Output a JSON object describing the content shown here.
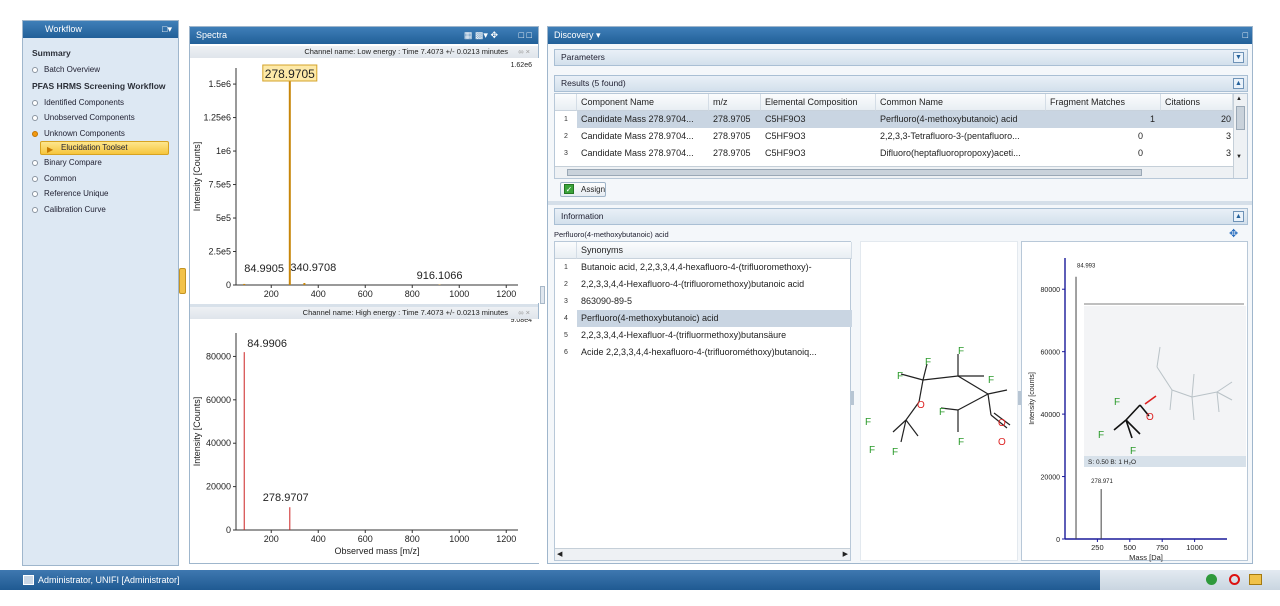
{
  "workflow": {
    "title": "Workflow",
    "items": [
      {
        "label": "Summary",
        "type": "header"
      },
      {
        "label": "Batch Overview",
        "type": "item"
      },
      {
        "label": "PFAS HRMS Screening Workflow",
        "type": "header"
      },
      {
        "label": "Identified Components",
        "type": "item"
      },
      {
        "label": "Unobserved Components",
        "type": "item"
      },
      {
        "label": "Unknown Components",
        "type": "item",
        "status": "active"
      },
      {
        "label": "Elucidation Toolset",
        "type": "selected"
      },
      {
        "label": "Binary Compare",
        "type": "item"
      },
      {
        "label": "Common",
        "type": "item"
      },
      {
        "label": "Reference Unique",
        "type": "item"
      },
      {
        "label": "Calibration Curve",
        "type": "item"
      }
    ]
  },
  "spectra": {
    "title": "Spectra",
    "low": {
      "channel": "Channel name: Low energy : Time 7.4073 +/- 0.0213 minutes",
      "scale": "1.62e6",
      "ylabel": "Intensity [Counts]",
      "yticks": [
        "1.5e6",
        "1.25e6",
        "1e6",
        "7.5e5",
        "5e5",
        "2.5e5",
        "0"
      ],
      "xticks": [
        "200",
        "400",
        "600",
        "800",
        "1000",
        "1200"
      ],
      "peak_labels": [
        "278.9705",
        "84.9905",
        "340.9708",
        "916.1066"
      ]
    },
    "high": {
      "channel": "Channel name: High energy : Time 7.4073 +/- 0.0213 minutes",
      "scale": "9.08e4",
      "ylabel": "Intensity [Counts]",
      "xlabel": "Observed mass [m/z]",
      "yticks": [
        "80000",
        "60000",
        "40000",
        "20000",
        "0"
      ],
      "xticks": [
        "200",
        "400",
        "600",
        "800",
        "1000",
        "1200"
      ],
      "peak_labels": [
        "84.9906",
        "278.9707"
      ]
    }
  },
  "chart_data": [
    {
      "type": "bar",
      "title": "Channel name: Low energy : Time 7.4073 +/- 0.0213 minutes",
      "ylabel": "Intensity [Counts]",
      "xlim": [
        50,
        1250
      ],
      "ylim": [
        0,
        1620000
      ],
      "x": [
        84.9905,
        278.9705,
        340.9708,
        916.1066
      ],
      "values": [
        8000,
        1620000,
        15000,
        3000
      ]
    },
    {
      "type": "bar",
      "title": "Channel name: High energy : Time 7.4073 +/- 0.0213 minutes",
      "xlabel": "Observed mass [m/z]",
      "ylabel": "Intensity [Counts]",
      "xlim": [
        50,
        1250
      ],
      "ylim": [
        0,
        90800
      ],
      "x": [
        84.9906,
        278.9707
      ],
      "values": [
        82000,
        10500
      ]
    },
    {
      "type": "bar",
      "xlabel": "Mass [Da]",
      "ylabel": "Intensity [counts]",
      "xlim": [
        0,
        1250
      ],
      "ylim": [
        0,
        90000
      ],
      "x": [
        84.993,
        278.971
      ],
      "values": [
        84000,
        16000
      ]
    }
  ],
  "discovery": {
    "title": "Discovery ▾",
    "parameters": "Parameters",
    "results": "Results (5 found)",
    "columns": [
      "Component Name",
      "m/z",
      "Elemental Composition",
      "Common Name",
      "Fragment Matches",
      "Citations"
    ],
    "rows": [
      {
        "n": "1",
        "name": "Candidate Mass 278.9704...",
        "mz": "278.9705",
        "comp": "C5HF9O3",
        "common": "Perfluoro(4-methoxybutanoic) acid",
        "frag": "1",
        "cit": "20"
      },
      {
        "n": "2",
        "name": "Candidate Mass 278.9704...",
        "mz": "278.9705",
        "comp": "C5HF9O3",
        "common": "2,2,3,3-Tetrafluoro-3-(pentafluoro...",
        "frag": "0",
        "cit": "3"
      },
      {
        "n": "3",
        "name": "Candidate Mass 278.9704...",
        "mz": "278.9705",
        "comp": "C5HF9O3",
        "common": "Difluoro(heptafluoropropoxy)aceti...",
        "frag": "0",
        "cit": "3"
      }
    ],
    "assign": "Assign",
    "information": "Information",
    "compound": "Perfluoro(4-methoxybutanoic) acid",
    "syn_header": "Synonyms",
    "synonyms": [
      {
        "n": "1",
        "v": "Butanoic acid, 2,2,3,3,4,4-hexafluoro-4-(trifluoromethoxy)-"
      },
      {
        "n": "2",
        "v": "2,2,3,3,4,4-Hexafluoro-4-(trifluoromethoxy)butanoic acid"
      },
      {
        "n": "3",
        "v": "863090-89-5"
      },
      {
        "n": "4",
        "v": "Perfluoro(4-methoxybutanoic) acid"
      },
      {
        "n": "5",
        "v": "2,2,3,3,4,4-Hexafluor-4-(trifluormethoxy)butansäure"
      },
      {
        "n": "6",
        "v": "Acide 2,2,3,3,4,4-hexafluoro-4-(trifluorométhoxy)butanoiq..."
      }
    ],
    "mini": {
      "ylabel": "Intensity [counts]",
      "xlabel": "Mass [Da]",
      "yticks": [
        "80000",
        "60000",
        "40000",
        "20000",
        "0"
      ],
      "xticks": [
        "250",
        "500",
        "750",
        "1000"
      ],
      "peak_labels": [
        "84.993",
        "278.971"
      ],
      "frag_score": "S: 0.50 B: 1 H₂O"
    }
  },
  "status": {
    "user": "Administrator, UNIFI [Administrator]"
  },
  "colors": {
    "title_bar": "#215f98",
    "low_peak": "#c8860a",
    "high_peak": "#cc2222",
    "fluorine": "#2a9a2a",
    "oxygen": "#dd2222",
    "selection": "#c9d5e2"
  }
}
